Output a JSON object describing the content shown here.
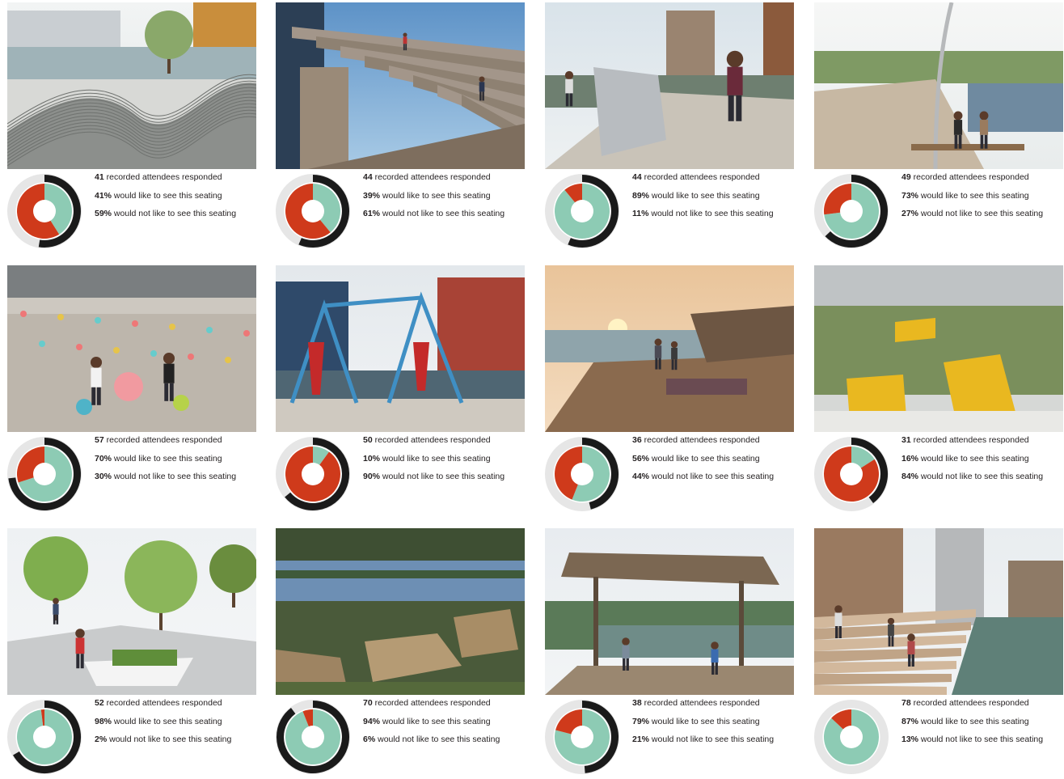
{
  "colors": {
    "like": "#8dcbb4",
    "dislike": "#cf3a1b",
    "count_arc": "#1a1a1a",
    "ring_bg": "#e6e6e6"
  },
  "phrases": {
    "responded": "recorded attendees responded",
    "like": "would like to see this seating",
    "dislike": "would not like to see this seating"
  },
  "chart_data": {
    "type": "pie",
    "max_respondents": 78,
    "panels": [
      {
        "photo": "wave-deck-waterfront",
        "respondents": 41,
        "like_pct": 41,
        "dislike_pct": 59
      },
      {
        "photo": "timber-stepped-terraces",
        "respondents": 44,
        "like_pct": 39,
        "dislike_pct": 61
      },
      {
        "photo": "steel-riverwalk-benches",
        "respondents": 44,
        "like_pct": 89,
        "dislike_pct": 11
      },
      {
        "photo": "curved-boardwalk-bench",
        "respondents": 49,
        "like_pct": 73,
        "dislike_pct": 27
      },
      {
        "photo": "plaza-cafe-chairs",
        "respondents": 57,
        "like_pct": 70,
        "dislike_pct": 30
      },
      {
        "photo": "harbor-swings",
        "respondents": 50,
        "like_pct": 10,
        "dislike_pct": 90
      },
      {
        "photo": "sunset-lounge-deck",
        "respondents": 36,
        "like_pct": 56,
        "dislike_pct": 44
      },
      {
        "photo": "yellow-folded-seats",
        "respondents": 31,
        "like_pct": 16,
        "dislike_pct": 84
      },
      {
        "photo": "white-planter-bench",
        "respondents": 52,
        "like_pct": 98,
        "dislike_pct": 2
      },
      {
        "photo": "shoreline-boulders",
        "respondents": 70,
        "like_pct": 94,
        "dislike_pct": 6
      },
      {
        "photo": "shade-pavilion-dock",
        "respondents": 38,
        "like_pct": 79,
        "dislike_pct": 21
      },
      {
        "photo": "riverwalk-steps",
        "respondents": 78,
        "like_pct": 87,
        "dislike_pct": 13
      }
    ]
  }
}
